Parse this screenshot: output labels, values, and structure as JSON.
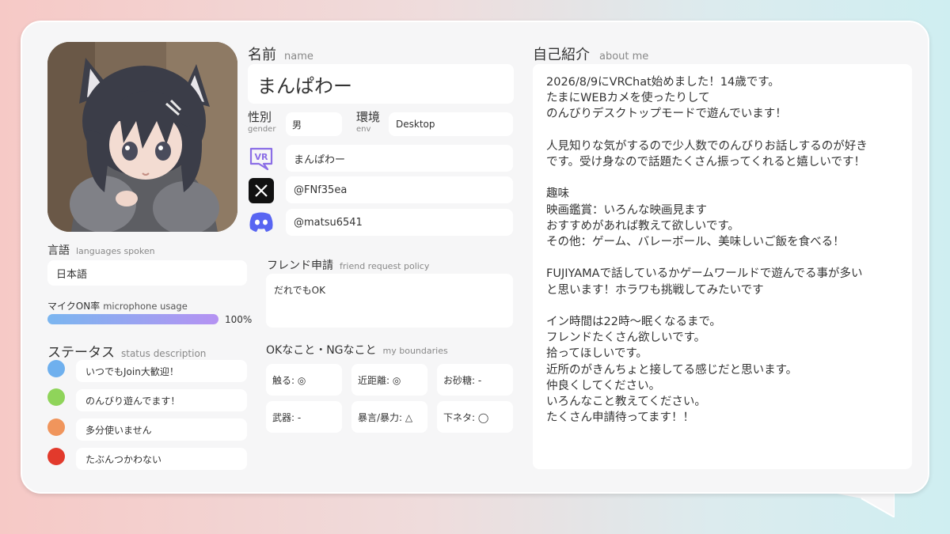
{
  "name_section": {
    "label": "名前",
    "label_en": "name",
    "value": "まんぱわー"
  },
  "gender": {
    "label": "性別",
    "label_en": "gender",
    "value": "男"
  },
  "env": {
    "label": "環境",
    "label_en": "env",
    "value": "Desktop"
  },
  "socials": {
    "vrchat": "まんぱわー",
    "x": "@FNf35ea",
    "discord": "@matsu6541"
  },
  "languages": {
    "label": "言語",
    "label_en": "languages spoken",
    "value": "日本語"
  },
  "mic": {
    "label": "マイクON率",
    "label_en": "microphone usage",
    "percent_label": "100%",
    "percent": 100,
    "bar_start": "#7bb6f0",
    "bar_end": "#b592f2"
  },
  "status": {
    "label": "ステータス",
    "label_en": "status description",
    "items": [
      {
        "color": "#6fb0ee",
        "text": "いつでもJoin大歓迎！"
      },
      {
        "color": "#8fd45a",
        "text": "のんびり遊んでます！"
      },
      {
        "color": "#f0955c",
        "text": "多分使いません"
      },
      {
        "color": "#e23a2c",
        "text": "たぶんつかわない"
      }
    ]
  },
  "friend_request": {
    "label": "フレンド申請",
    "label_en": "friend request policy",
    "value": "だれでもOK"
  },
  "boundaries": {
    "label": "OKなこと・NGなこと",
    "label_en": "my boundaries",
    "items": [
      "触る: ◎",
      "近距離: ◎",
      "お砂糖: -",
      "武器: -",
      "暴言/暴力: △",
      "下ネタ: ◯"
    ]
  },
  "about": {
    "label": "自己紹介",
    "label_en": "about me",
    "text": "2026/8/9にVRChat始めました！14歳です。\nたまにWEBカメを使ったりして\nのんびりデスクトップモードで遊んでいます！\n\n人見知りな気がするので少人数でのんびりお話しするのが好き\nです。受け身なので話題たくさん振ってくれると嬉しいです！\n\n趣味\n映画鑑賞：いろんな映画見ます\nおすすめがあれば教えて欲しいです。\nその他：ゲーム、バレーボール、美味しいご飯を食べる！\n\nFUJIYAMAで話しているかゲームワールドで遊んでる事が多い\nと思います！ホラワも挑戦してみたいです\n\nイン時間は22時〜眠くなるまで。\nフレンドたくさん欲しいです。\n拾ってほしいです。\n近所のがきんちょと接してる感じだと思います。\n仲良くしてください。\nいろんなこと教えてください。\nたくさん申請待ってます！！"
  },
  "colors": {
    "card_bg": "#f6f6f7",
    "box_bg": "#ffffff",
    "discord": "#5865f2",
    "vrchat_icon": "#8b6ee6"
  }
}
